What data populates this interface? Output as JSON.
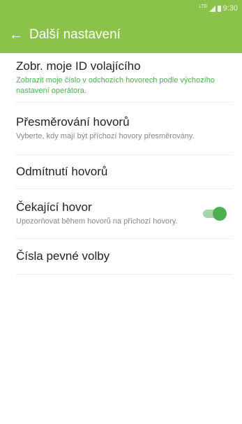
{
  "status_bar": {
    "network": "LTE",
    "time": "9:30"
  },
  "app_bar": {
    "back_icon": "arrow-left-icon",
    "title": "Další nastavení"
  },
  "settings": [
    {
      "title": "Zobr. moje ID volajícího",
      "subtitle": "Zobrazit moje číslo v odchozích hovorech podle výchozího nastavení operátora."
    },
    {
      "title": "Přesměrování hovorů",
      "subtitle": "Vyberte, kdy mají být příchozí hovory přesměrovány."
    },
    {
      "title": "Odmítnutí hovorů"
    },
    {
      "title": "Čekající hovor",
      "subtitle": "Upozorňovat během hovorů na příchozí hovory.",
      "toggle_on": true
    },
    {
      "title": "Čísla pevné volby"
    }
  ],
  "colors": {
    "accent": "#8bc34a",
    "toggle_on": "#4caf50",
    "subtitle_highlight": "#4caf50"
  }
}
